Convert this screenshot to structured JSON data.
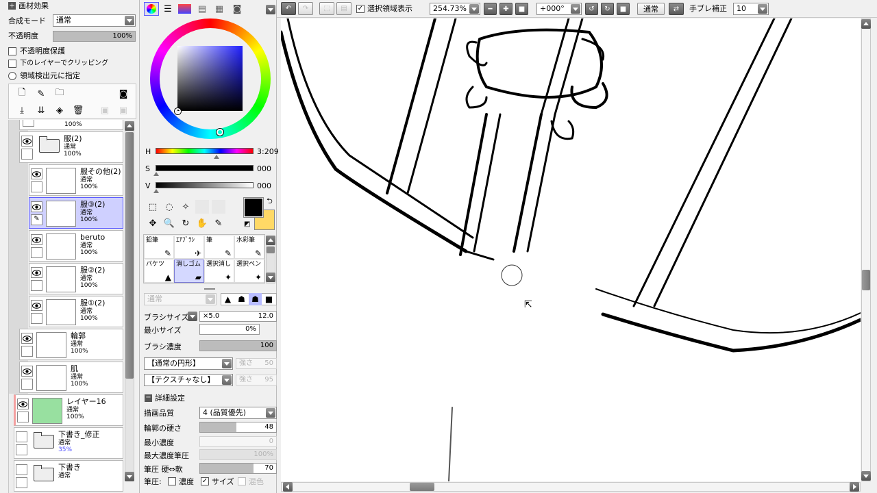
{
  "toolbar": {
    "show_selection_label": "選択領域表示",
    "zoom": "254.73%",
    "rotation": "+000°",
    "blend_mode": "通常",
    "stabilizer_label": "手ブレ補正",
    "stabilizer_value": "10"
  },
  "layer_panel": {
    "title": "画材効果",
    "blend_mode_label": "合成モード",
    "blend_mode_value": "通常",
    "opacity_label": "不透明度",
    "opacity_value": "100%",
    "opacity_fraction": 1.0,
    "protect_opacity": "不透明度保護",
    "clip_lower": "下のレイヤーでクリッピング",
    "region_source": "領域検出元に指定",
    "top_partial_opacity": "100%",
    "layers": [
      {
        "name": "服(2)",
        "mode": "通常",
        "opacity": "100%",
        "folder": true
      },
      {
        "name": "服その他(2)",
        "mode": "通常",
        "opacity": "100%"
      },
      {
        "name": "服③(2)",
        "mode": "通常",
        "opacity": "100%",
        "selected": true
      },
      {
        "name": "beruto",
        "mode": "通常",
        "opacity": "100%"
      },
      {
        "name": "服②(2)",
        "mode": "通常",
        "opacity": "100%"
      },
      {
        "name": "服①(2)",
        "mode": "通常",
        "opacity": "100%"
      },
      {
        "name": "輪郭",
        "mode": "通常",
        "opacity": "100%"
      },
      {
        "name": "肌",
        "mode": "通常",
        "opacity": "100%"
      },
      {
        "name": "レイヤー16",
        "mode": "通常",
        "opacity": "100%"
      },
      {
        "name": "下書き_修正",
        "mode": "通常",
        "opacity": "35%",
        "folder": true
      },
      {
        "name": "下書き",
        "mode": "通常",
        "opacity": "",
        "folder": true
      }
    ]
  },
  "color_panel": {
    "h_label": "H",
    "h_value": "3:209",
    "s_label": "S",
    "s_value": "000",
    "v_label": "V",
    "v_value": "000",
    "primary_color": "#000000",
    "secondary_color": "#ffd966"
  },
  "brushes": [
    {
      "label": "鉛筆",
      "icon": "✎"
    },
    {
      "label": "ｴｱﾌﾞﾗｼ",
      "icon": "✈"
    },
    {
      "label": "筆",
      "icon": "✎"
    },
    {
      "label": "水彩筆",
      "icon": "✎"
    },
    {
      "label": "バケツ",
      "icon": "▲"
    },
    {
      "label": "消しゴム",
      "icon": "▰",
      "active": true
    },
    {
      "label": "選択消し",
      "icon": "✦"
    },
    {
      "label": "選択ペン",
      "icon": "✦"
    }
  ],
  "tool_settings": {
    "mode": "通常",
    "brush_size_label": "ブラシサイズ",
    "brush_size_mult": "×5.0",
    "brush_size_value": "12.0",
    "min_size_label": "最小サイズ",
    "min_size_value": "0%",
    "min_size_fraction": 0.0,
    "density_label": "ブラシ濃度",
    "density_value": "100",
    "density_fraction": 1.0,
    "shape": "【通常の円形】",
    "shape_strength_label": "強さ",
    "shape_strength": "50",
    "texture": "【テクスチャなし】",
    "texture_strength_label": "強さ",
    "texture_strength": "95",
    "advanced_label": "詳細設定",
    "quality_label": "描画品質",
    "quality_value": "4 (品質優先)",
    "hardness_label": "輪郭の硬さ",
    "hardness_value": "48",
    "hardness_fraction": 0.48,
    "min_density_label": "最小濃度",
    "min_density_value": "0",
    "max_density_label": "最大濃度筆圧",
    "max_density_value": "100%",
    "pressure_label": "筆圧 硬⇔軟",
    "pressure_value": "70",
    "pressure_fraction": 0.7,
    "pressure_opts_label": "筆圧:",
    "opt_density": "濃度",
    "opt_size": "サイズ",
    "opt_blend": "混色"
  },
  "colors": {
    "accent_selected": "#cfd0ff",
    "draft_layer_color": "#98e0a0"
  }
}
